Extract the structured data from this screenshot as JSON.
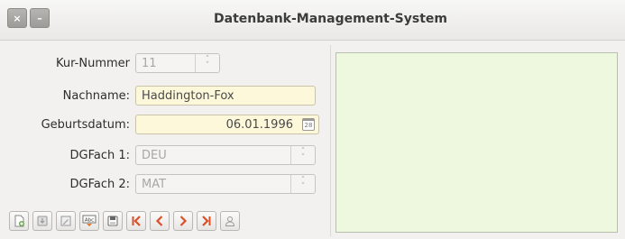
{
  "window": {
    "title": "Datenbank-Management-System",
    "close_label": "×",
    "minimize_label": "–"
  },
  "form": {
    "kur_nummer": {
      "label": "Kur-Nummer",
      "value": "11"
    },
    "nachname": {
      "label": "Nachname:",
      "value": "Haddington-Fox"
    },
    "geburtsdatum": {
      "label": "Geburtsdatum:",
      "value": "06.01.1996",
      "calendar_text": "28"
    },
    "dgfach1": {
      "label": "DGFach 1:",
      "value": "DEU"
    },
    "dgfach2": {
      "label": "DGFach 2:",
      "value": "MAT"
    }
  },
  "toolbar": {
    "buttons": [
      "new-record-icon",
      "save-record-icon",
      "edit-icon",
      "spellcheck-icon",
      "floppy-icon",
      "first-record-icon",
      "previous-record-icon",
      "next-record-icon",
      "last-record-icon",
      "user-icon"
    ],
    "spellcheck_text": "Abc"
  },
  "colors": {
    "nav_accent": "#d9502a",
    "preview_bg": "#eef8df",
    "field_highlight": "#fdf8d9"
  }
}
